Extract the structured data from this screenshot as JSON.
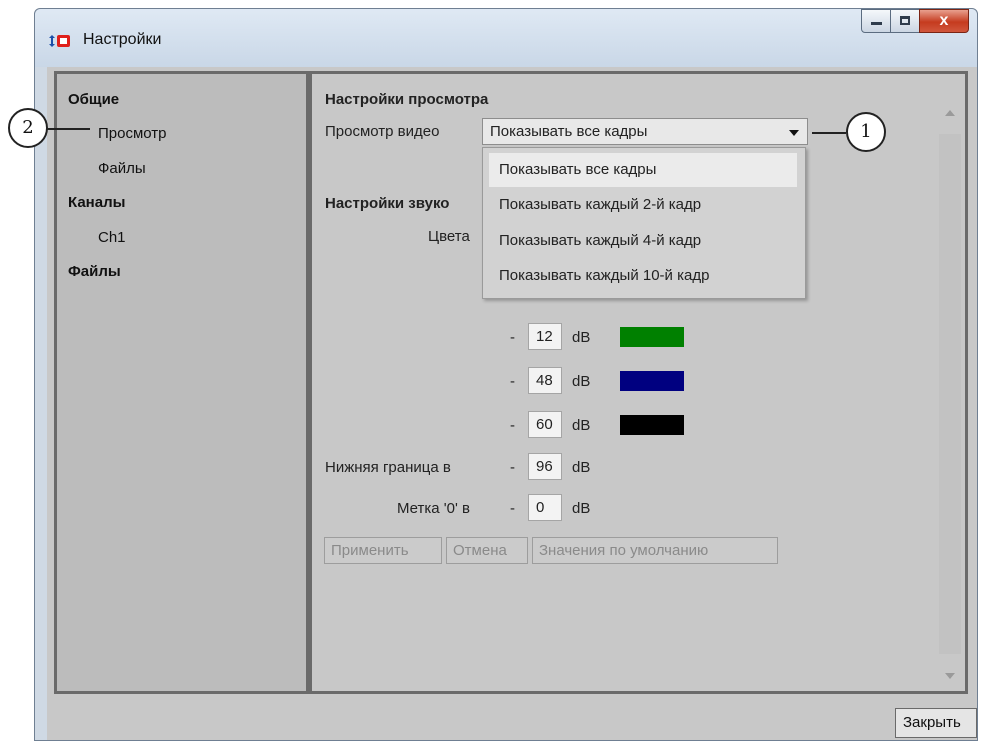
{
  "window": {
    "title": "Настройки",
    "close_glyph": "x",
    "buttons": [
      "minimize-icon",
      "maximize-icon",
      "close-icon"
    ]
  },
  "nav": {
    "items": [
      {
        "label": "Общие",
        "level": 0
      },
      {
        "label": "Просмотр",
        "level": 1
      },
      {
        "label": "Файлы",
        "level": 1
      },
      {
        "label": "Каналы",
        "level": 0
      },
      {
        "label": "Ch1",
        "level": 1
      },
      {
        "label": "Файлы",
        "level": 0
      }
    ]
  },
  "view_settings": {
    "title": "Настройки просмотра",
    "video_label": "Просмотр видео",
    "video_value": "Показывать все кадры",
    "options": [
      "Показывать все кадры",
      "Показывать каждый 2-й кадр",
      "Показывать каждый 4-й кадр",
      "Показывать каждый 10-й кадр"
    ]
  },
  "sound_settings": {
    "title": "Настройки звуко",
    "colors_label": "Цвета",
    "dash": "-",
    "unit": "dB",
    "levels": [
      {
        "value": "12",
        "color": "#008000"
      },
      {
        "value": "48",
        "color": "#000080"
      },
      {
        "value": "60",
        "color": "#000000"
      }
    ],
    "lower_bound_label": "Нижняя граница в",
    "lower_bound_value": "96",
    "zero_mark_label": "Метка '0' в",
    "zero_mark_value": "0"
  },
  "actions": {
    "apply": "Применить",
    "cancel": "Отмена",
    "defaults": "Значения по умолчанию",
    "close": "Закрыть"
  },
  "callouts": {
    "one": "1",
    "two": "2"
  }
}
